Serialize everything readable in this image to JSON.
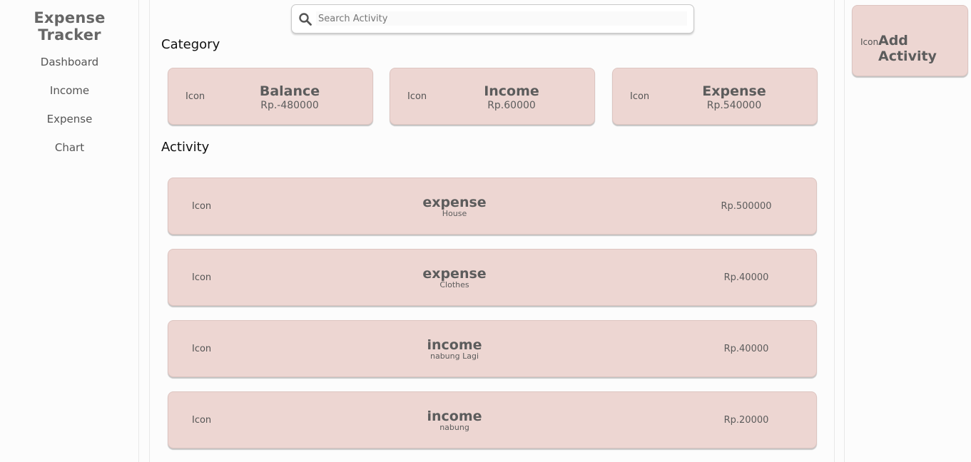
{
  "app": {
    "title": "Expense Tracker"
  },
  "nav": {
    "items": [
      {
        "label": "Dashboard"
      },
      {
        "label": "Income"
      },
      {
        "label": "Expense"
      },
      {
        "label": "Chart"
      }
    ]
  },
  "search": {
    "placeholder": "Search Activity",
    "value": "",
    "icon": "search-icon"
  },
  "sections": {
    "category": "Category",
    "activity": "Activity"
  },
  "categories": [
    {
      "icon": "Icon",
      "name": "Balance",
      "amount": "Rp.-480000"
    },
    {
      "icon": "Icon",
      "name": "Income",
      "amount": "Rp.60000"
    },
    {
      "icon": "Icon",
      "name": "Expense",
      "amount": "Rp.540000"
    }
  ],
  "activities": [
    {
      "icon": "Icon",
      "type": "expense",
      "desc": "House",
      "amount": "Rp.500000"
    },
    {
      "icon": "Icon",
      "type": "expense",
      "desc": "Clothes",
      "amount": "Rp.40000"
    },
    {
      "icon": "Icon",
      "type": "income",
      "desc": "nabung Lagi",
      "amount": "Rp.40000"
    },
    {
      "icon": "Icon",
      "type": "income",
      "desc": "nabung",
      "amount": "Rp.20000"
    }
  ],
  "add_activity": {
    "icon": "Icon",
    "label": "Add Activity"
  },
  "colors": {
    "card": "#edd6d2",
    "text": "#5c5c5c",
    "background": "#fcfcfc"
  }
}
